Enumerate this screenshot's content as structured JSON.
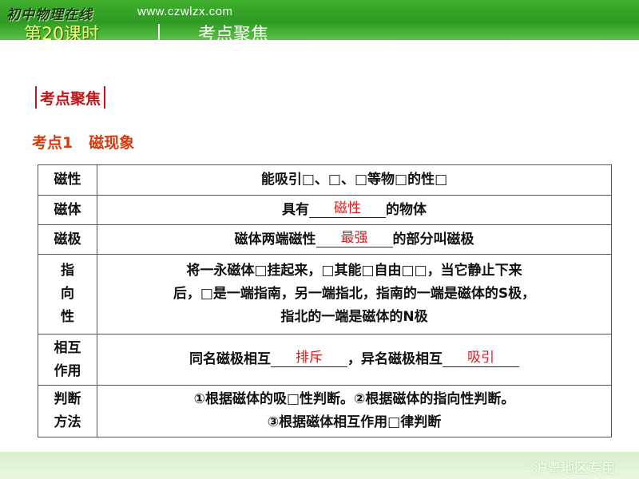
{
  "header": {
    "logo_text": "初中物理在线",
    "site_url": "www.czwlzx.com",
    "lesson_title": "第20课时",
    "topic": "考点聚焦"
  },
  "section_heading": "考点聚焦",
  "topic": {
    "number": "考点1",
    "name": "磁现象"
  },
  "table": {
    "rows": [
      {
        "label": "磁性",
        "text": "能吸引□、□、□等物□的性□"
      },
      {
        "label": "磁体",
        "pre": "具有",
        "answer": "磁性",
        "post": "的物体"
      },
      {
        "label": "磁极",
        "pre": "磁体两端磁性",
        "answer": "最强",
        "post": "的部分叫磁极"
      },
      {
        "label_lines": [
          "指",
          "向",
          "性"
        ],
        "lines": [
          "将一永磁体□挂起来，□其能□自由□□，当它静止下来",
          "后，□是一端指南，另一端指北，指南的一端是磁体的S极，",
          "指北的一端是磁体的N极"
        ]
      },
      {
        "label_lines": [
          "相互",
          "作用"
        ],
        "pre": "同名磁极相互",
        "answer1": "排斥",
        "mid": "，异名磁极相互",
        "answer2": "吸引"
      },
      {
        "label_lines": [
          "判断",
          "方法"
        ],
        "lines": [
          "①根据磁体的吸□性判断。②根据磁体的指向性判断。",
          "③根据磁体相互作用□律判断"
        ]
      }
    ]
  },
  "footer": {
    "text": "沪粤地区专用"
  }
}
